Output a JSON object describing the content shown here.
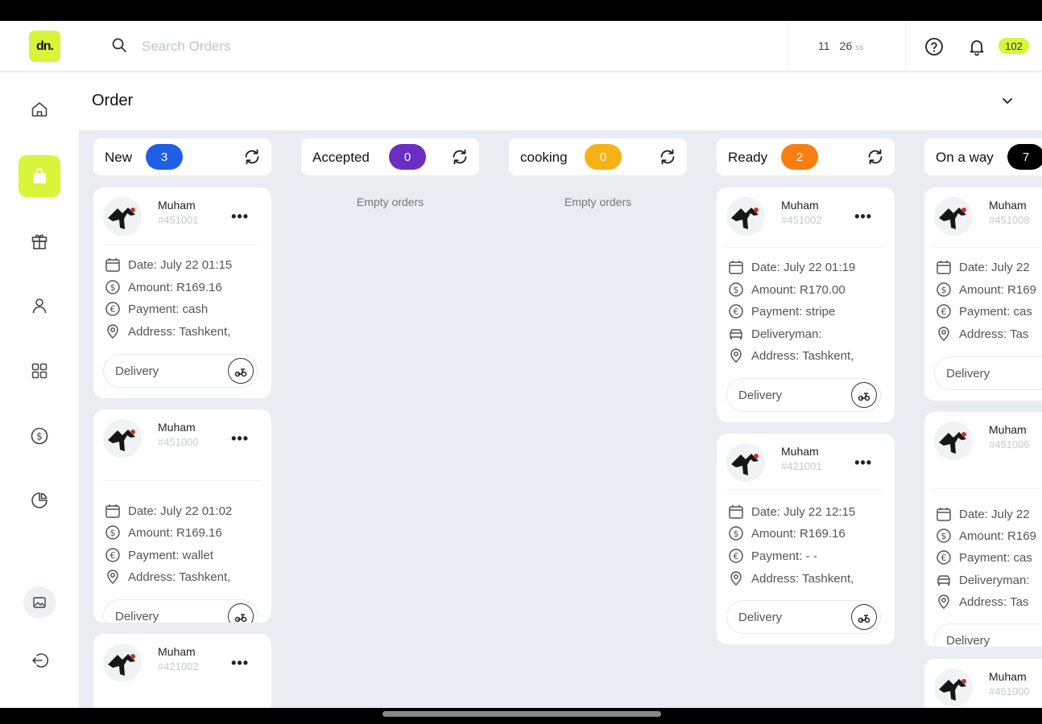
{
  "app": {
    "logo_text": "dn."
  },
  "topbar": {
    "search_placeholder": "Search Orders",
    "clock_hours": "11",
    "clock_minutes": "26",
    "clock_seconds": "ss",
    "notification_count": "102"
  },
  "page": {
    "title": "Order"
  },
  "columns": [
    {
      "name": "New",
      "count": "3",
      "color": "#1e5fe6",
      "empty_text": ""
    },
    {
      "name": "Accepted",
      "count": "0",
      "color": "#6a2fc2",
      "empty_text": "Empty orders"
    },
    {
      "name": "cooking",
      "count": "0",
      "color": "#f7b217",
      "empty_text": "Empty orders"
    },
    {
      "name": "Ready",
      "count": "2",
      "color": "#f97e12",
      "empty_text": ""
    },
    {
      "name": "On a way",
      "count": "7",
      "color": "#000000",
      "empty_text": ""
    }
  ],
  "cards": {
    "new": [
      {
        "name": "Muham",
        "id": "#451001",
        "date": "Date: July 22 01:15",
        "amount": "Amount: R169.16",
        "payment": "Payment: cash",
        "address": "Address: Tashkent,",
        "delivery": "Delivery"
      },
      {
        "name": "Muham",
        "id": "#451000",
        "date": "Date: July 22 01:02",
        "amount": "Amount: R169.16",
        "payment": "Payment: wallet",
        "address": "Address: Tashkent,",
        "delivery": "Delivery"
      },
      {
        "name": "Muham",
        "id": "#421002"
      }
    ],
    "ready": [
      {
        "name": "Muham",
        "id": "#451002",
        "date": "Date: July 22 01:19",
        "amount": "Amount: R170.00",
        "payment": "Payment: stripe",
        "deliveryman": "Deliveryman:",
        "address": "Address: Tashkent,",
        "delivery": "Delivery"
      },
      {
        "name": "Muham",
        "id": "#421001",
        "date": "Date: July 22 12:15",
        "amount": "Amount: R169.16",
        "payment": "Payment: - -",
        "address": "Address: Tashkent,",
        "delivery": "Delivery"
      }
    ],
    "onway": [
      {
        "name": "Muham",
        "id": "#451008",
        "date": "Date: July 22",
        "amount": "Amount: R169",
        "payment": "Payment: cas",
        "address": "Address: Tas",
        "delivery": "Delivery"
      },
      {
        "name": "Muham",
        "id": "#451006",
        "date": "Date: July 22",
        "amount": "Amount: R169",
        "payment": "Payment: cas",
        "deliveryman": "Deliveryman:",
        "address": "Address: Tas",
        "delivery": "Delivery"
      },
      {
        "name": "Muham",
        "id": "#451000"
      }
    ]
  }
}
